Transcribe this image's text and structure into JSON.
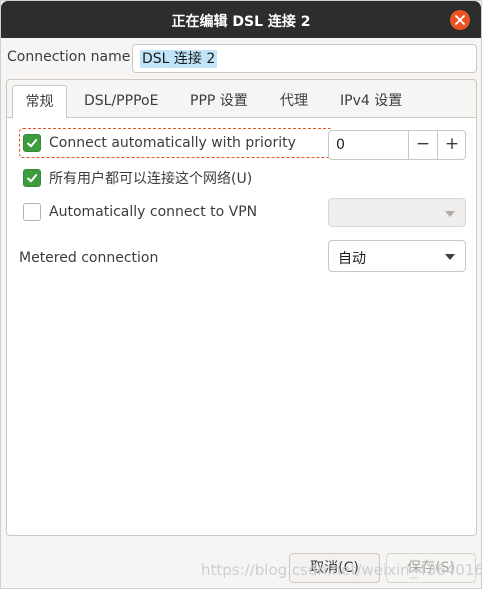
{
  "window": {
    "title": "正在编辑 DSL 连接 2"
  },
  "connection": {
    "label": "Connection name",
    "value": "DSL 连接 2"
  },
  "tabs": [
    {
      "label": "常规",
      "active": true
    },
    {
      "label": "DSL/PPPoE"
    },
    {
      "label": "PPP 设置"
    },
    {
      "label": "代理"
    },
    {
      "label": "IPv4 设置"
    }
  ],
  "general": {
    "auto_connect": {
      "label": "Connect automatically with priority",
      "checked": true
    },
    "priority": {
      "value": "0",
      "minus": "−",
      "plus": "+"
    },
    "all_users": {
      "label": "所有用户都可以连接这个网络(U)",
      "checked": true
    },
    "auto_vpn": {
      "label": "Automatically connect to VPN",
      "checked": false,
      "selected": ""
    },
    "metered": {
      "label": "Metered connection",
      "value": "自动"
    }
  },
  "buttons": {
    "cancel": "取消(C)",
    "save": "保存(S)"
  },
  "watermark": "https://blog.csdn.net/weixin_43640166",
  "colors": {
    "accent": "#e95420",
    "check": "#3c9d3f",
    "titlebar": "#2d2d2d",
    "selection": "#bfe4f7"
  }
}
